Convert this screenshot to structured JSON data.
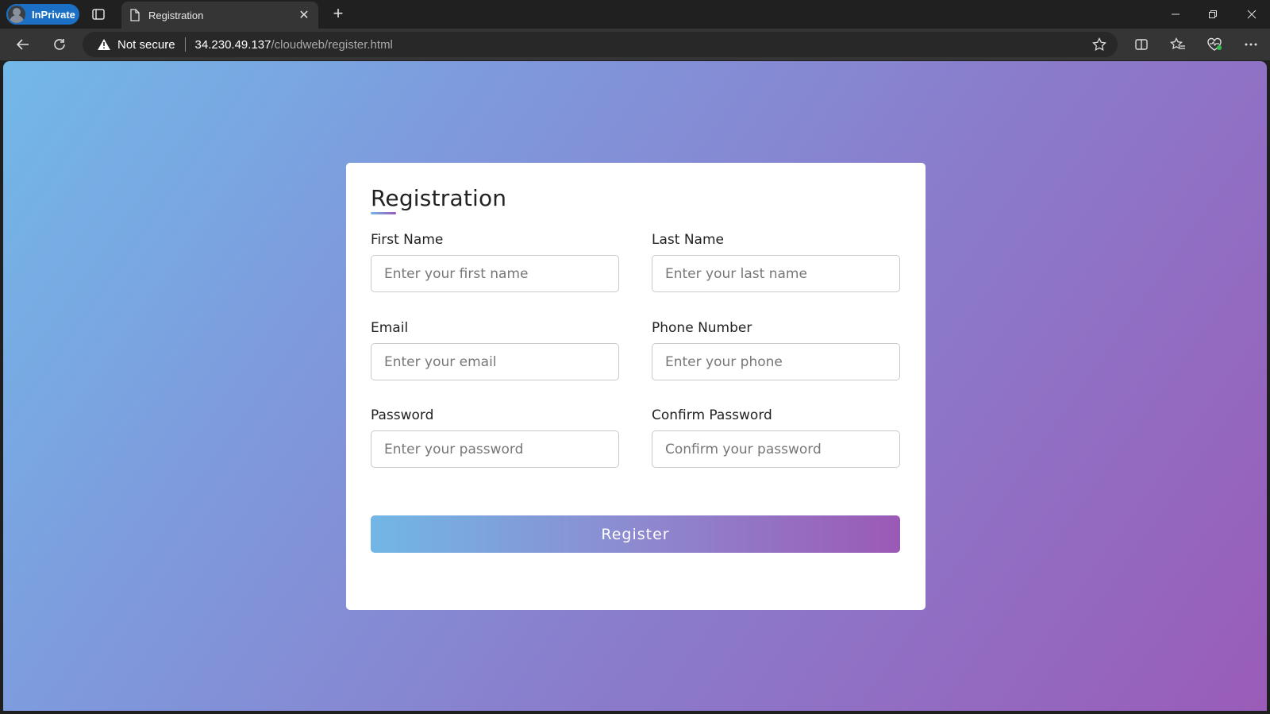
{
  "browser": {
    "profile_label": "InPrivate",
    "tab_title": "Registration",
    "address": {
      "security_label": "Not secure",
      "host": "34.230.49.137",
      "path": "/cloudweb/register.html"
    }
  },
  "form": {
    "title": "Registration",
    "fields": [
      {
        "label": "First Name",
        "placeholder": "Enter your first name",
        "value": ""
      },
      {
        "label": "Last Name",
        "placeholder": "Enter your last name",
        "value": ""
      },
      {
        "label": "Email",
        "placeholder": "Enter your email",
        "value": ""
      },
      {
        "label": "Phone Number",
        "placeholder": "Enter your phone",
        "value": ""
      },
      {
        "label": "Password",
        "placeholder": "Enter your password",
        "value": ""
      },
      {
        "label": "Confirm Password",
        "placeholder": "Confirm your password",
        "value": ""
      }
    ],
    "submit_label": "Register"
  },
  "colors": {
    "gradient_start": "#71b7e6",
    "gradient_end": "#9b59b6",
    "inprivate_badge": "#1b6fc4"
  }
}
